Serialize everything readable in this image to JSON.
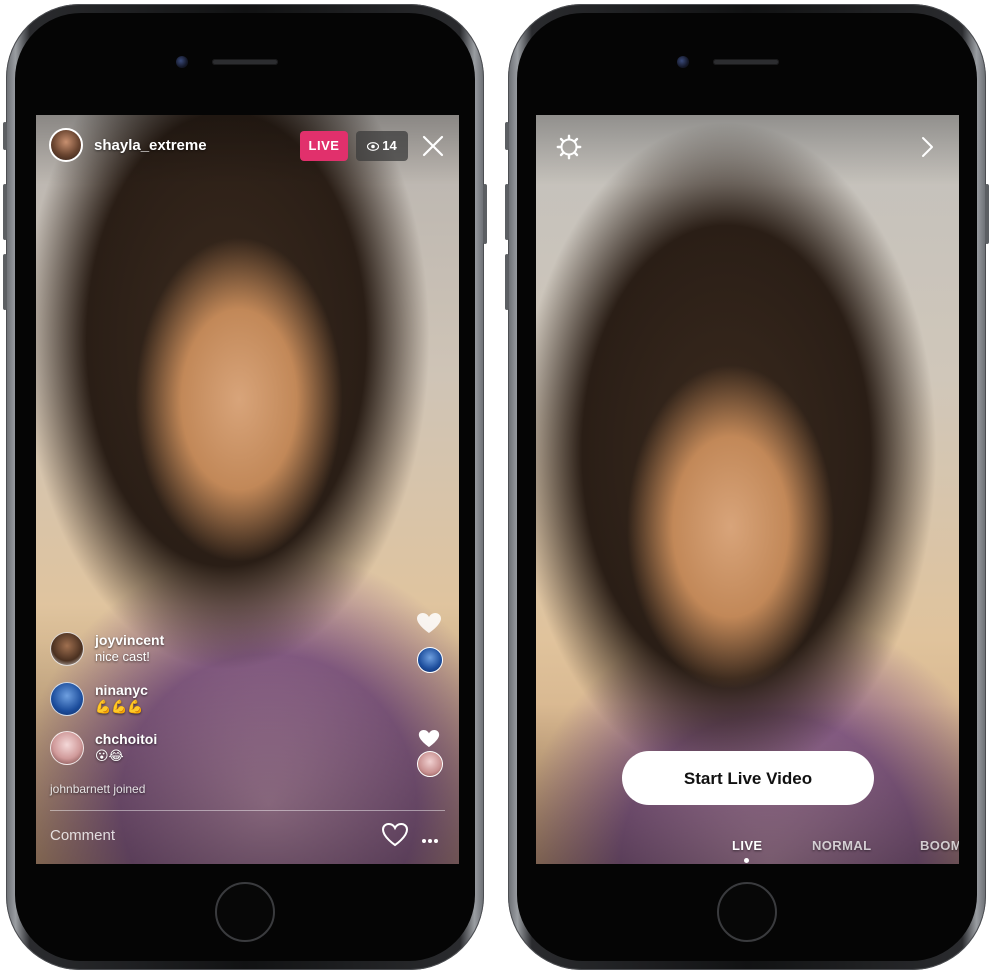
{
  "left_phone": {
    "broadcaster": {
      "username": "shayla_extreme"
    },
    "live_label": "LIVE",
    "viewer_count": "14",
    "comments": [
      {
        "user": "joyvincent",
        "text": "nice cast!"
      },
      {
        "user": "ninanyc",
        "text": "💪💪💪"
      },
      {
        "user": "chchoitoi",
        "text": "😮😂"
      }
    ],
    "joined_text": "johnbarnett joined",
    "comment_placeholder": "Comment",
    "icons": {
      "eye": "eye-icon",
      "close": "close-icon",
      "heart": "heart-icon",
      "more": "more-options-icon"
    }
  },
  "right_phone": {
    "start_button_label": "Start Live Video",
    "modes": [
      {
        "label": "LIVE",
        "active": true
      },
      {
        "label": "NORMAL",
        "active": false
      },
      {
        "label": "BOOM",
        "active": false
      }
    ],
    "icons": {
      "settings": "gear-icon",
      "next": "chevron-right-icon"
    }
  },
  "colors": {
    "live_badge": "#e1306c",
    "button_bg": "#ffffff"
  }
}
